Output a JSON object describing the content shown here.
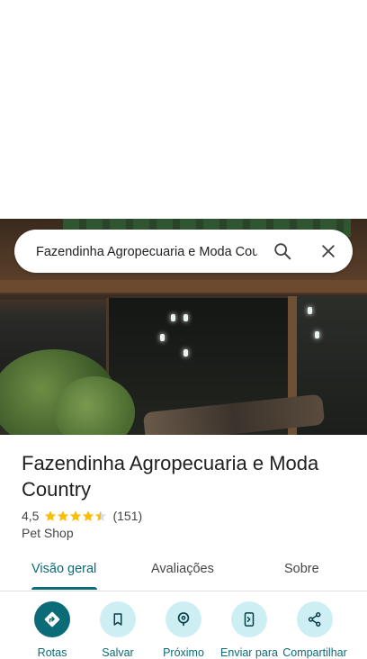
{
  "search": {
    "query": "Fazendinha Agropecuaria e Moda Country",
    "search_icon": "search-icon",
    "close_icon": "close-icon"
  },
  "place": {
    "name": "Fazendinha Agropecuaria e Moda Country",
    "rating": "4,5",
    "stars": 4.5,
    "review_count": "(151)",
    "category": "Pet Shop",
    "star_color": "#fbbc04"
  },
  "tabs": [
    {
      "label": "Visão geral",
      "active": true
    },
    {
      "label": "Avaliações",
      "active": false
    },
    {
      "label": "Sobre",
      "active": false
    }
  ],
  "actions": [
    {
      "label": "Rotas",
      "icon": "directions-icon"
    },
    {
      "label": "Salvar",
      "icon": "bookmark-icon"
    },
    {
      "label": "Próximo",
      "icon": "nearby-icon"
    },
    {
      "label": "Enviar para",
      "icon": "send-to-phone-icon"
    },
    {
      "label": "Compartilhar",
      "icon": "share-icon"
    }
  ],
  "colors": {
    "accent": "#0b6b77",
    "action_bg": "#cdeff4"
  }
}
